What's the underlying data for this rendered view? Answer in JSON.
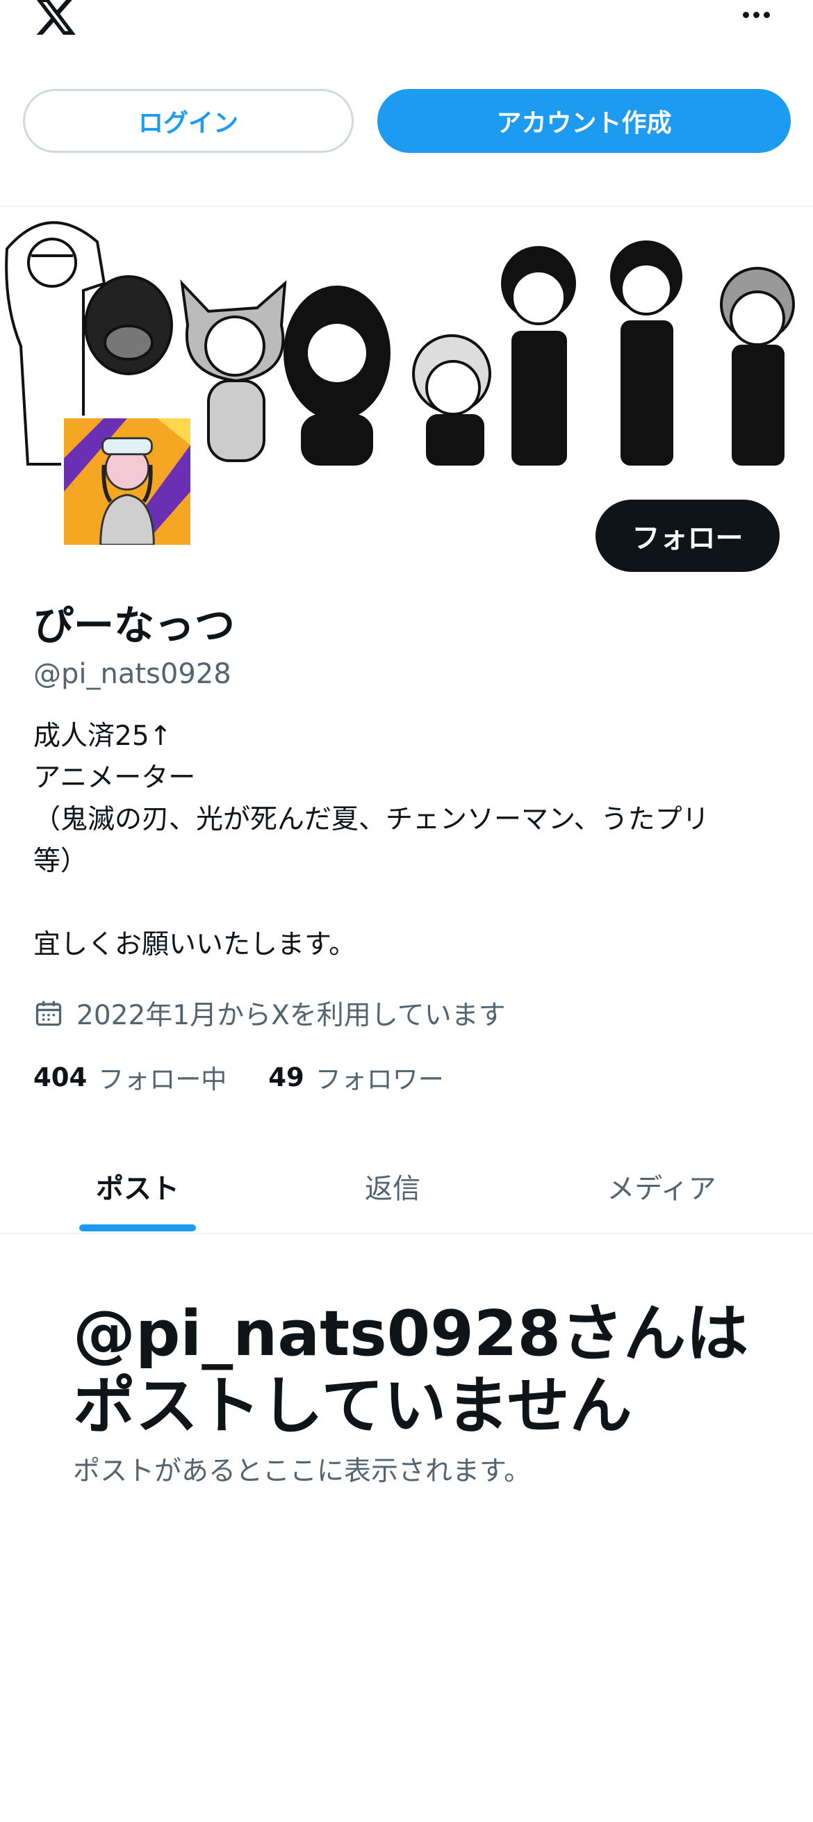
{
  "topbar": {
    "logo_icon": "x-logo-icon",
    "more_icon": "more-horizontal-icon"
  },
  "auth": {
    "login_label": "ログイン",
    "signup_label": "アカウント作成"
  },
  "profile": {
    "display_name": "ぴーなっつ",
    "handle": "@pi_nats0928",
    "follow_label": "フォロー",
    "bio_lines": [
      "成人済25↑",
      "アニメーター",
      "（鬼滅の刃、光が死んだ夏、チェンソーマン、うたプリ",
      "等）",
      "",
      "宜しくお願いいたします。"
    ],
    "joined": "2022年1月からXを利用しています",
    "following_count": "404",
    "following_label": "フォロー中",
    "followers_count": "49",
    "followers_label": "フォロワー"
  },
  "tabs": [
    {
      "label": "ポスト"
    },
    {
      "label": "返信"
    },
    {
      "label": "メディア"
    }
  ],
  "empty_state": {
    "title": "@pi_nats0928さんはポストしていません",
    "subtitle": "ポストがあるとここに表示されます。"
  },
  "colors": {
    "accent": "#1d9bf0",
    "text": "#0f1419",
    "muted": "#536471",
    "border": "#cfd9de"
  }
}
